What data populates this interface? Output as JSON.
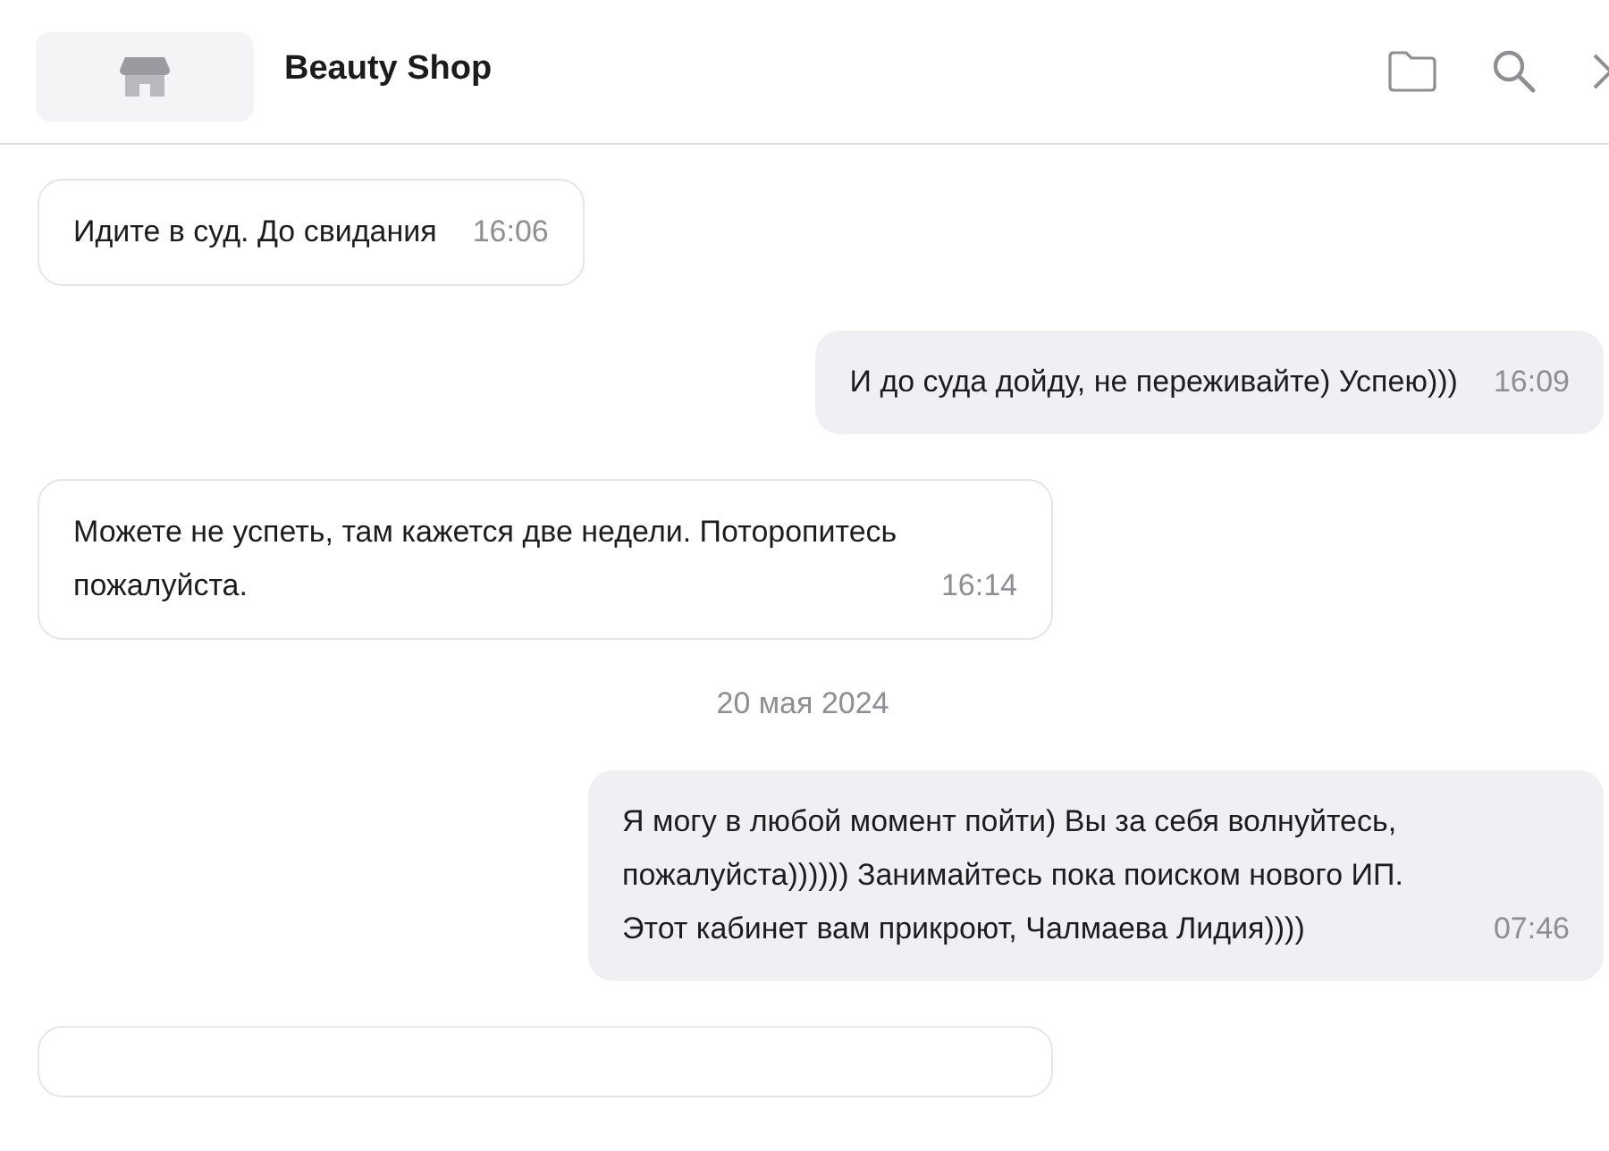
{
  "header": {
    "title": "Beauty Shop"
  },
  "messages": [
    {
      "kind": "incoming",
      "text": "Идите в суд. До свидания",
      "time": "16:06"
    },
    {
      "kind": "outgoing",
      "text": "И до суда дойду, не переживайте) Успею)))",
      "time": "16:09"
    },
    {
      "kind": "incoming",
      "text": "Можете не успеть, там кажется две недели. Поторопитесь пожалуйста.",
      "time": "16:14"
    },
    {
      "kind": "date",
      "text": "20 мая 2024"
    },
    {
      "kind": "outgoing",
      "text": "Я могу в любой момент пойти) Вы за себя волнуйтесь, пожалуйста)))))) Занимайтесь пока поиском нового ИП. Этот кабинет вам прикроют, Чалмаева Лидия))))",
      "time": "07:46"
    },
    {
      "kind": "incoming"
    }
  ]
}
